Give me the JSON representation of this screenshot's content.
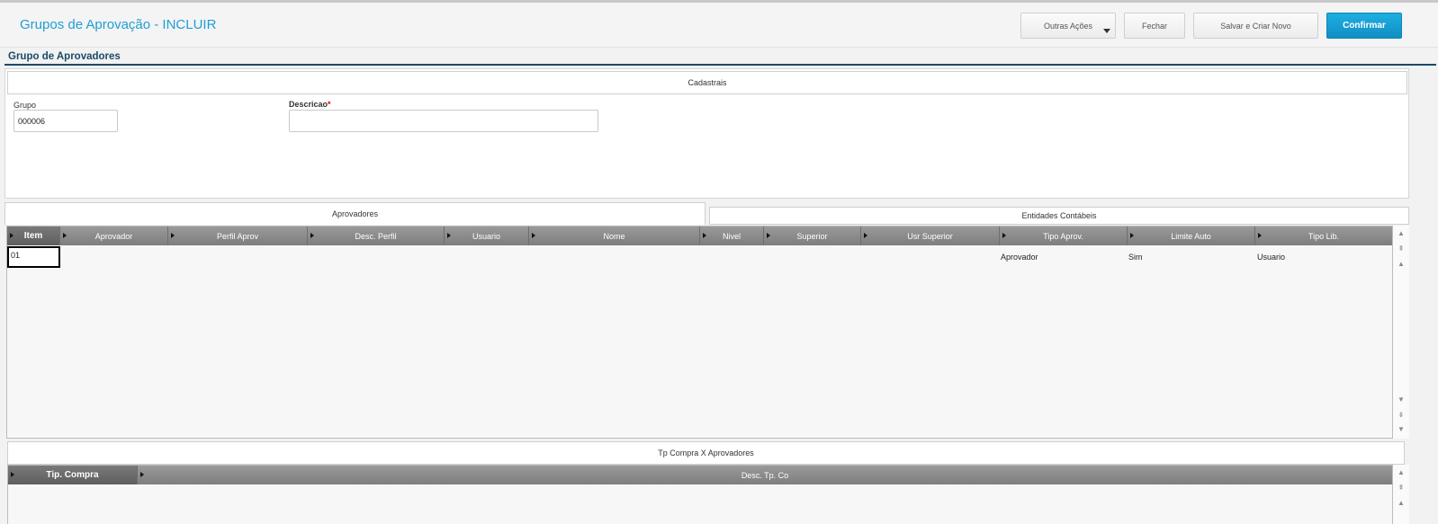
{
  "header": {
    "title": "Grupos de Aprovação - INCLUIR",
    "buttons": {
      "outras_acoes": "Outras Ações",
      "fechar": "Fechar",
      "salvar_novo": "Salvar e Criar Novo",
      "confirmar": "Confirmar"
    }
  },
  "section": {
    "title": "Grupo de Aprovadores"
  },
  "cadastrais": {
    "title": "Cadastrais",
    "grupo_label": "Grupo",
    "grupo_value": "000006",
    "descricao_label": "Descricao",
    "required_mark": "*",
    "descricao_value": ""
  },
  "tabs": {
    "aprovadores": "Aprovadores",
    "entidades": "Entidades Contábeis"
  },
  "grid_aprovadores": {
    "columns": [
      "Item",
      "Aprovador",
      "Perfil Aprov",
      "Desc. Perfil",
      "Usuario",
      "Nome",
      "Nivel",
      "Superior",
      "Usr Superior",
      "Tipo Aprov.",
      "Limite Auto",
      "Tipo Lib."
    ],
    "row": {
      "item": "01",
      "tipo_aprov": "Aprovador",
      "limite_auto": "Sim",
      "tipo_lib": "Usuario"
    }
  },
  "tp_compra": {
    "title": "Tp Compra X Aprovadores",
    "columns": [
      "Tip. Compra",
      "Desc. Tp. Co"
    ]
  },
  "icons": {
    "scroll_up": "▲",
    "scroll_top": "⇞",
    "scroll_down": "▼",
    "scroll_bottom": "⇟"
  },
  "colors": {
    "title_blue": "#1e9fd2",
    "primary_button": "#0f8fc4",
    "section_dark_blue": "#1a4a68",
    "grid_header": "#8a8a8a"
  }
}
